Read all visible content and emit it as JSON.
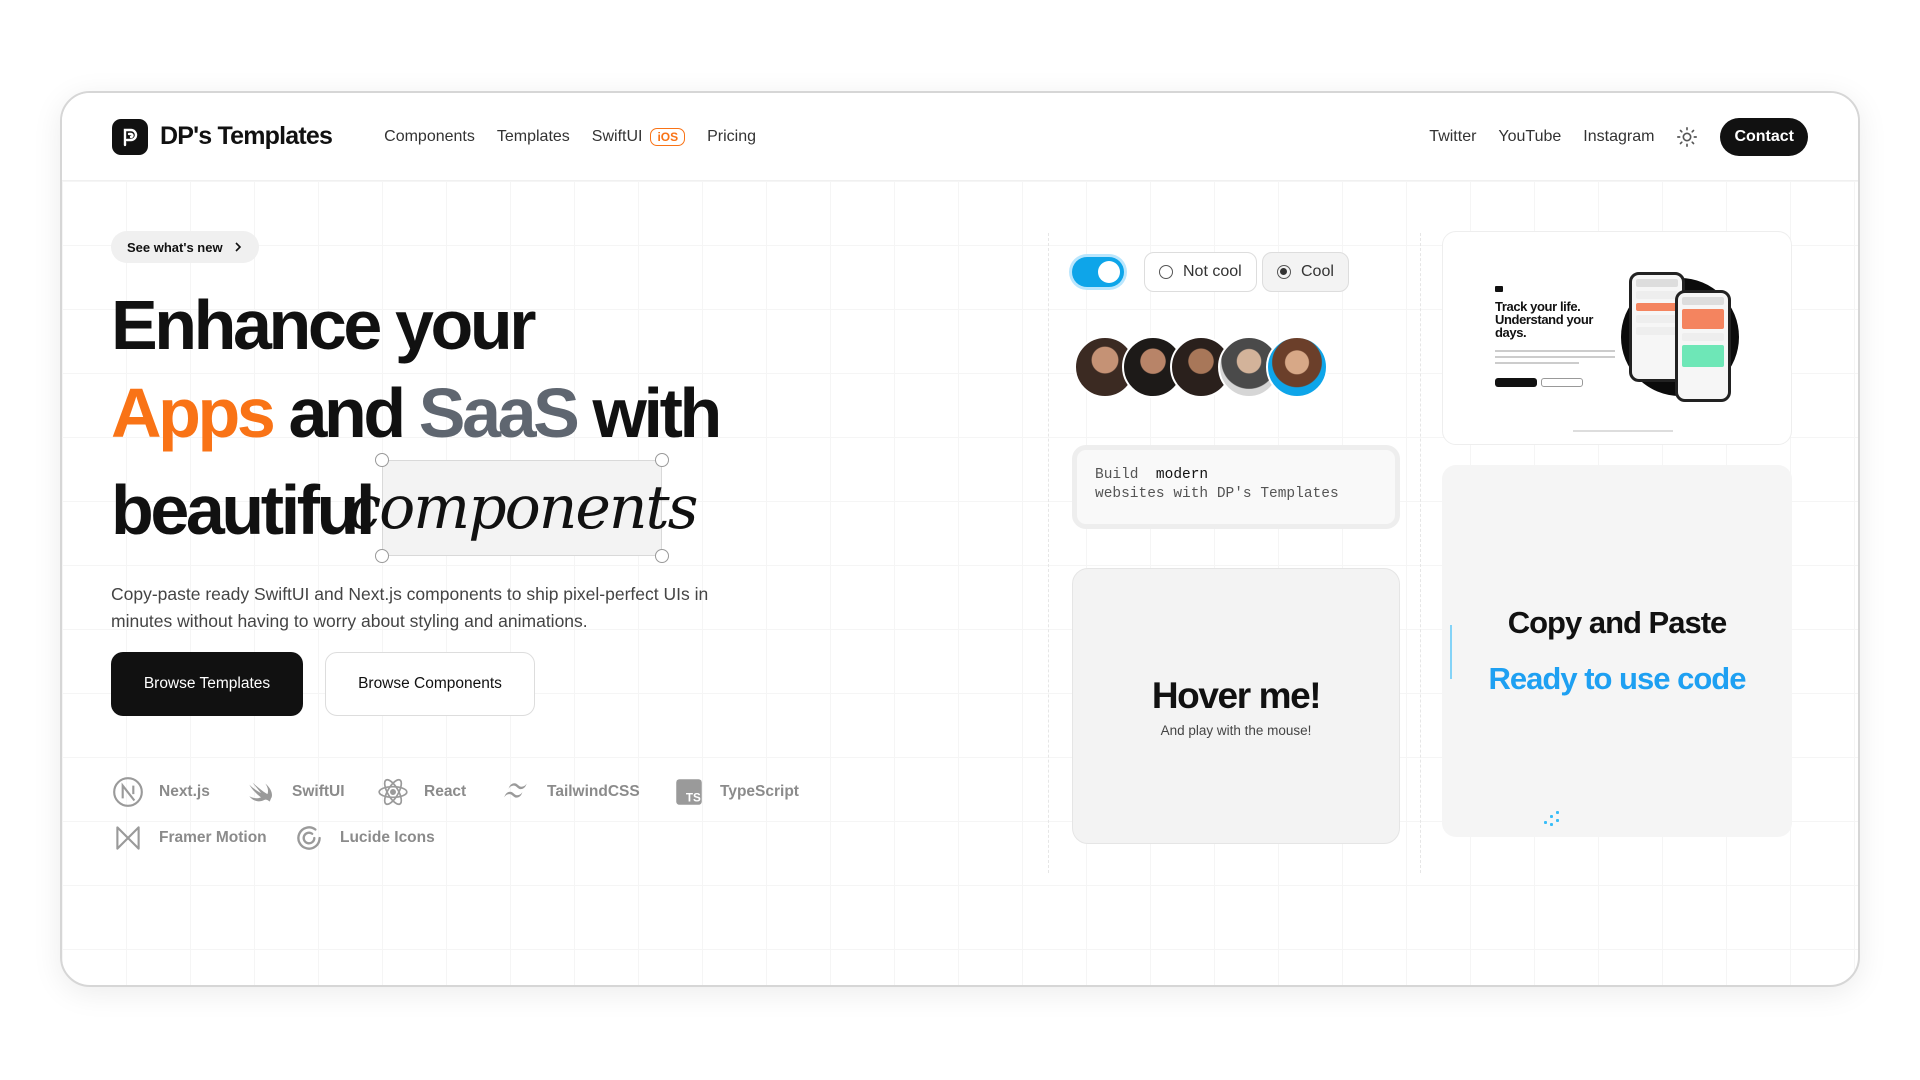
{
  "nav": {
    "brand": "DP's Templates",
    "links": [
      "Components",
      "Templates",
      "SwiftUI",
      "Pricing"
    ],
    "ios_badge": "iOS",
    "social": [
      "Twitter",
      "YouTube",
      "Instagram"
    ],
    "contact": "Contact"
  },
  "hero": {
    "badge": "See what's new",
    "line1": "Enhance your",
    "apps": "Apps",
    "and": "and",
    "saas": "SaaS",
    "with": "with",
    "beautiful": "beautiful",
    "components": "components",
    "description": "Copy-paste ready SwiftUI and Next.js components to ship pixel-perfect UIs in minutes without having to worry about styling and animations.",
    "primary_button": "Browse Templates",
    "secondary_button": "Browse Components"
  },
  "tech": [
    {
      "name": "Next.js",
      "icon": "nextjs-icon"
    },
    {
      "name": "SwiftUI",
      "icon": "swift-icon"
    },
    {
      "name": "React",
      "icon": "react-icon"
    },
    {
      "name": "TailwindCSS",
      "icon": "tailwind-icon"
    },
    {
      "name": "TypeScript",
      "icon": "typescript-icon"
    },
    {
      "name": "Framer Motion",
      "icon": "framer-motion-icon"
    },
    {
      "name": "Lucide Icons",
      "icon": "lucide-icon"
    }
  ],
  "widgets": {
    "toggle_on": true,
    "radio_not_cool": "Not cool",
    "radio_cool": "Cool",
    "radio_selected": "Cool",
    "build_line1_a": "Build",
    "build_line1_b": "modern",
    "build_line2": "websites with DP's Templates",
    "hover_title": "Hover me!",
    "hover_sub": "And play with the mouse!"
  },
  "app_preview": {
    "title": "Track your life. Understand your days."
  },
  "copy_card": {
    "title": "Copy and Paste",
    "subtitle": "Ready to use code"
  },
  "colors": {
    "accent_orange": "#f97316",
    "accent_blue": "#1ea0f2",
    "toggle_blue": "#0ea5e9",
    "saas_gray": "#5f6670"
  }
}
